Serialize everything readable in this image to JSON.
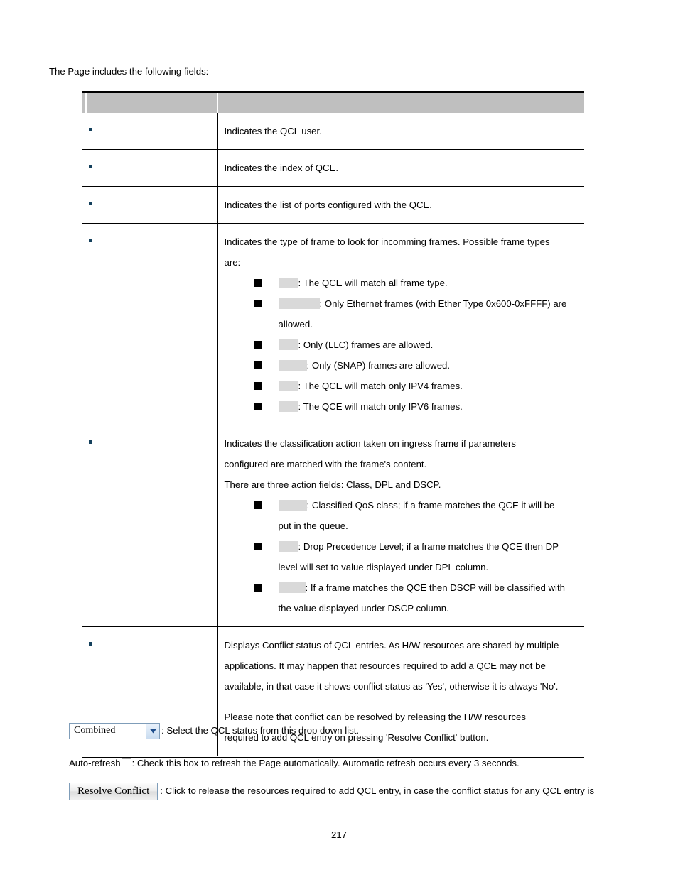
{
  "document": {
    "intro": "The Page includes the following fields:",
    "page_number": "217"
  },
  "table": {
    "header": {
      "name_col": "",
      "desc_col": ""
    },
    "rows": [
      {
        "name": "",
        "lines": [
          "Indicates the QCL user."
        ]
      },
      {
        "name": "",
        "lines": [
          "Indicates the index of QCE."
        ]
      },
      {
        "name": "",
        "lines": [
          "Indicates the list of ports configured with the QCE."
        ]
      },
      {
        "name": "",
        "lines": [
          "Indicates the type of frame to look for incomming frames. Possible frame types",
          "are:"
        ],
        "sub_items": [
          {
            "label": "",
            "label_width": 28,
            "text": ": The QCE will match all frame type."
          },
          {
            "label": "",
            "label_width": 58,
            "text": ": Only Ethernet frames (with Ether Type 0x600-0xFFFF) are",
            "continuation": "allowed."
          },
          {
            "label": "",
            "label_width": 28,
            "text": ": Only (LLC) frames are allowed."
          },
          {
            "label": "",
            "label_width": 40,
            "text": ": Only (SNAP) frames are allowed."
          },
          {
            "label": "",
            "label_width": 28,
            "text": ": The QCE will match only IPV4 frames."
          },
          {
            "label": "",
            "label_width": 28,
            "text": ": The QCE will match only IPV6 frames."
          }
        ]
      },
      {
        "name": "",
        "lines": [
          "Indicates the classification action taken on ingress frame if parameters",
          "configured are matched with the frame's content.",
          "There are three action fields: Class, DPL and DSCP."
        ],
        "sub_items": [
          {
            "label": "",
            "label_width": 40,
            "text": ": Classified QoS class; if a frame matches the QCE it will be",
            "continuation": "put in the queue."
          },
          {
            "label": "",
            "label_width": 28,
            "text": ": Drop Precedence Level; if a frame matches the QCE then DP",
            "continuation": "level will set to value displayed under DPL column."
          },
          {
            "label": "",
            "label_width": 38,
            "text": ": If a frame matches the QCE then DSCP will be classified with",
            "continuation": "the value displayed under DSCP column."
          }
        ]
      },
      {
        "name": "",
        "lines": [
          "Displays Conflict status of QCL entries. As H/W resources are shared by multiple",
          "applications. It may happen that resources required to add a QCE may not be",
          "available, in that case it shows conflict status as 'Yes', otherwise it is always 'No'.",
          "",
          "Please note that conflict can be resolved by releasing the H/W resources",
          "required to add QCL entry on pressing 'Resolve Conflict' button."
        ]
      }
    ]
  },
  "controls": {
    "status_select": {
      "value": "Combined",
      "arrow_icon": "chevron-down-icon",
      "description": ": Select the QCL status from this drop down list."
    },
    "auto_refresh": {
      "label": "Auto-refresh",
      "checkbox_icon": "checkbox-unchecked-icon",
      "checked": false,
      "description": ": Check this box to refresh the Page automatically. Automatic refresh occurs every 3 seconds."
    },
    "resolve_conflict": {
      "label": "Resolve Conflict",
      "description": ": Click to release the resources required to add QCL entry, in case the conflict status for any QCL entry is"
    }
  },
  "colors": {
    "header_gray": "#bfbfbf",
    "redaction_gray": "#d9d9d9",
    "bullet_navy": "#14405c",
    "control_border_blue": "#7f9db9"
  }
}
